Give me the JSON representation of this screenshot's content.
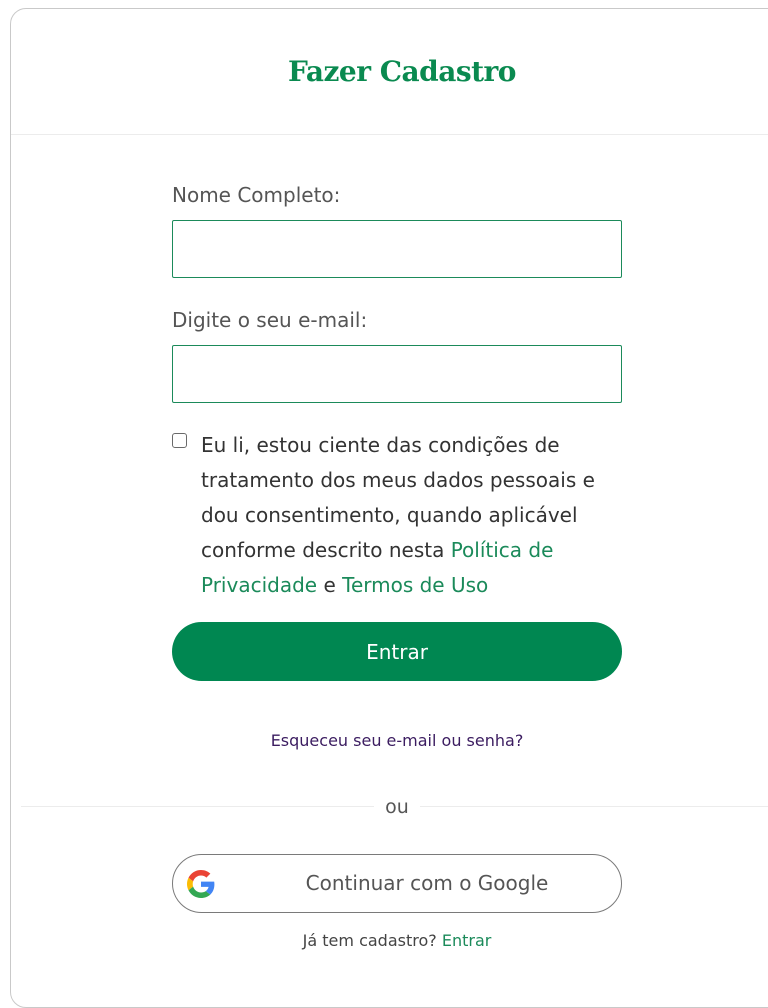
{
  "header": {
    "title": "Fazer Cadastro"
  },
  "form": {
    "name_label": "Nome Completo:",
    "name_value": "",
    "email_label": "Digite o seu e-mail:",
    "email_value": "",
    "consent": {
      "checked": false,
      "text_before": "Eu li, estou ciente das condições de tratamento dos meus dados pessoais e dou consentimento, quando aplicável conforme descrito nesta ",
      "privacy_link": "Política de Privacidade",
      "connector": " e ",
      "terms_link": "Termos de Uso"
    },
    "submit_label": "Entrar",
    "forgot_link": "Esqueceu seu e-mail ou senha?"
  },
  "divider": {
    "label": "ou"
  },
  "google": {
    "label": "Continuar com o Google",
    "icon": "google-g-icon"
  },
  "footer": {
    "question": "Já tem cadastro?",
    "login_link": "Entrar"
  },
  "colors": {
    "brand_green": "#008751",
    "link_green": "#1b8a5a",
    "link_purple": "#3b1c60"
  }
}
